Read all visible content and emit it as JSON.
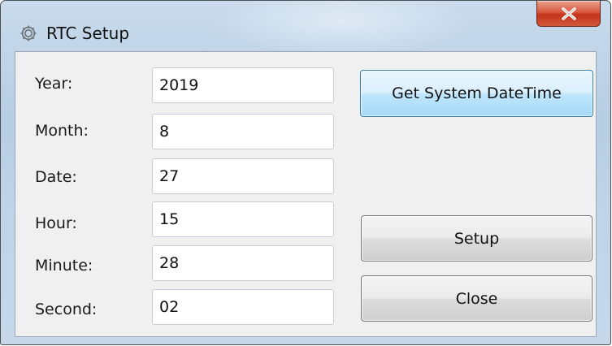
{
  "window": {
    "title": "RTC Setup",
    "icon": "gear-icon",
    "close_icon": "close-icon",
    "close_color": "#c3331a"
  },
  "fields": [
    {
      "label": "Year:",
      "value": "2019"
    },
    {
      "label": "Month:",
      "value": "8"
    },
    {
      "label": "Date:",
      "value": "27"
    },
    {
      "label": "Hour:",
      "value": "15"
    },
    {
      "label": "Minute:",
      "value": "28"
    },
    {
      "label": "Second:",
      "value": "02"
    }
  ],
  "buttons": {
    "get_system_datetime": "Get System DateTime",
    "setup": "Setup",
    "close": "Close"
  }
}
